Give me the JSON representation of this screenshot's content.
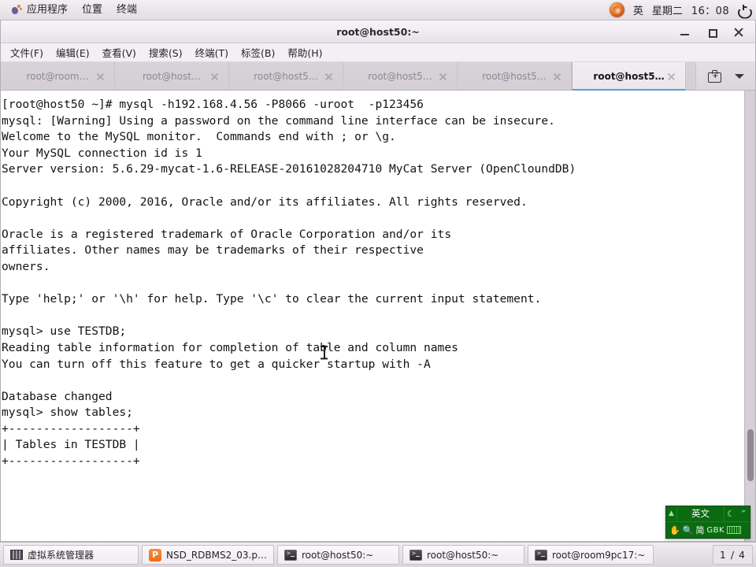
{
  "top_panel": {
    "menus": [
      {
        "label": "应用程序",
        "icon": "gnome-foot-icon"
      },
      {
        "label": "位置",
        "icon": ""
      },
      {
        "label": "终端",
        "icon": ""
      }
    ],
    "tray": {
      "firefox_icon": "firefox-icon",
      "input_method": "英",
      "day": "星期二",
      "time": "16：08",
      "power_icon": "power-icon"
    }
  },
  "window": {
    "title": "root@host50:~",
    "buttons": {
      "minimize": "minimize-button",
      "maximize": "maximize-button",
      "close": "close-button"
    },
    "menubar": [
      "文件(F)",
      "编辑(E)",
      "查看(V)",
      "搜索(S)",
      "终端(T)",
      "标签(B)",
      "帮助(H)"
    ],
    "tabs": [
      {
        "label": "root@room…",
        "active": false
      },
      {
        "label": "root@host…",
        "active": false
      },
      {
        "label": "root@host5…",
        "active": false
      },
      {
        "label": "root@host5…",
        "active": false
      },
      {
        "label": "root@host5…",
        "active": false
      },
      {
        "label": "root@host5…",
        "active": true
      }
    ],
    "tabbar_right": {
      "new_tab_icon": "new-terminal-icon",
      "overflow_icon": "chevron-down-icon"
    }
  },
  "terminal": {
    "content": "[root@host50 ~]# mysql -h192.168.4.56 -P8066 -uroot  -p123456\nmysql: [Warning] Using a password on the command line interface can be insecure.\nWelcome to the MySQL monitor.  Commands end with ; or \\g.\nYour MySQL connection id is 1\nServer version: 5.6.29-mycat-1.6-RELEASE-20161028204710 MyCat Server (OpenCloundDB)\n\nCopyright (c) 2000, 2016, Oracle and/or its affiliates. All rights reserved.\n\nOracle is a registered trademark of Oracle Corporation and/or its\naffiliates. Other names may be trademarks of their respective\nowners.\n\nType 'help;' or '\\h' for help. Type '\\c' to clear the current input statement.\n\nmysql> use TESTDB;\nReading table information for completion of table and column names\nYou can turn off this feature to get a quicker startup with -A\n\nDatabase changed\nmysql> show tables;\n+------------------+\n| Tables in TESTDB |\n+------------------+",
    "scrollbar": "vertical-scrollbar"
  },
  "ime": {
    "expand_icon": "▲",
    "mode": "英文",
    "moon_icon": "☾",
    "quote_icon": "”",
    "hand_icon": "✋",
    "search_icon": "🔍",
    "script": "简",
    "encoding": "GBK",
    "keyboard_icon": "keyboard-icon"
  },
  "taskbar": {
    "items": [
      {
        "label": "虚拟系统管理器",
        "icon": "virt-manager-icon"
      },
      {
        "label": "NSD_RDBMS2_03.ppt…",
        "icon": "powerpoint-icon"
      },
      {
        "label": "root@host50:~",
        "icon": "terminal-icon"
      },
      {
        "label": "root@host50:~",
        "icon": "terminal-icon"
      },
      {
        "label": "root@room9pc17:~",
        "icon": "terminal-icon"
      }
    ],
    "workspace": "1 / 4"
  }
}
